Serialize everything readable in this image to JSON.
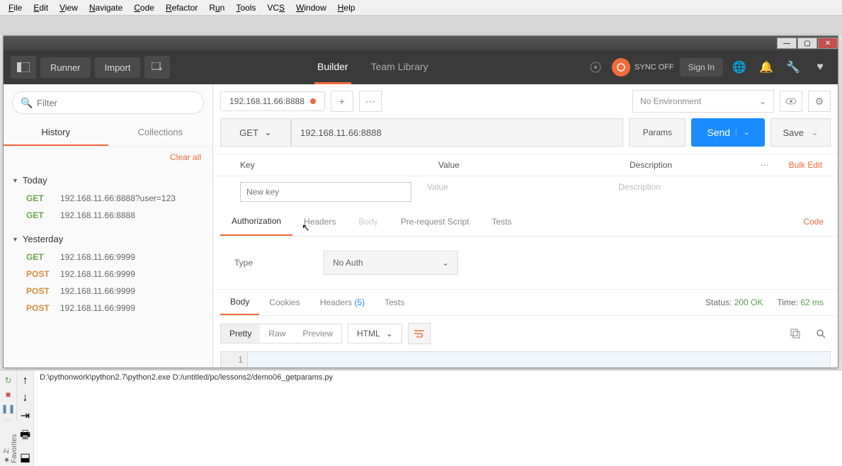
{
  "ide_menu": [
    "File",
    "Edit",
    "View",
    "Navigate",
    "Code",
    "Refactor",
    "Run",
    "Tools",
    "VCS",
    "Window",
    "Help"
  ],
  "header": {
    "runner": "Runner",
    "import": "Import",
    "tabs": {
      "builder": "Builder",
      "team": "Team Library"
    },
    "sync": "SYNC OFF",
    "signin": "Sign In"
  },
  "sidebar": {
    "filter_placeholder": "Filter",
    "tabs": {
      "history": "History",
      "collections": "Collections"
    },
    "clear_all": "Clear all",
    "groups": [
      {
        "label": "Today",
        "items": [
          {
            "method": "GET",
            "cls": "get",
            "url": "192.168.11.66:8888?user=123"
          },
          {
            "method": "GET",
            "cls": "get",
            "url": "192.168.11.66:8888"
          }
        ]
      },
      {
        "label": "Yesterday",
        "items": [
          {
            "method": "GET",
            "cls": "get",
            "url": "192.168.11.66:9999"
          },
          {
            "method": "POST",
            "cls": "post",
            "url": "192.168.11.66:9999"
          },
          {
            "method": "POST",
            "cls": "post",
            "url": "192.168.11.66:9999"
          },
          {
            "method": "POST",
            "cls": "post",
            "url": "192.168.11.66:9999"
          }
        ]
      }
    ]
  },
  "request": {
    "tab_title": "192.168.11.66:8888",
    "env": "No Environment",
    "method": "GET",
    "url": "192.168.11.66:8888",
    "params_btn": "Params",
    "send": "Send",
    "save": "Save"
  },
  "params_grid": {
    "headers": {
      "key": "Key",
      "value": "Value",
      "desc": "Description"
    },
    "bulk": "Bulk Edit",
    "placeholders": {
      "key": "New key",
      "value": "Value",
      "desc": "Description"
    }
  },
  "req_tabs": {
    "auth": "Authorization",
    "headers": "Headers",
    "body": "Body",
    "prescript": "Pre-request Script",
    "tests": "Tests",
    "code": "Code"
  },
  "auth": {
    "type_label": "Type",
    "selected": "No Auth"
  },
  "resp_tabs": {
    "body": "Body",
    "cookies": "Cookies",
    "headers": "Headers",
    "headers_count": "(5)",
    "tests": "Tests",
    "status_label": "Status:",
    "status_value": "200 OK",
    "time_label": "Time:",
    "time_value": "62 ms"
  },
  "view": {
    "pretty": "Pretty",
    "raw": "Raw",
    "preview": "Preview",
    "fmt": "HTML"
  },
  "code_line": "1",
  "console": {
    "cmd": "D:\\pythonwork\\python2.7\\python2.exe D:/untitled/pc/lessons2/demo06_getparams.py"
  },
  "fav_label": "2: Favorites"
}
